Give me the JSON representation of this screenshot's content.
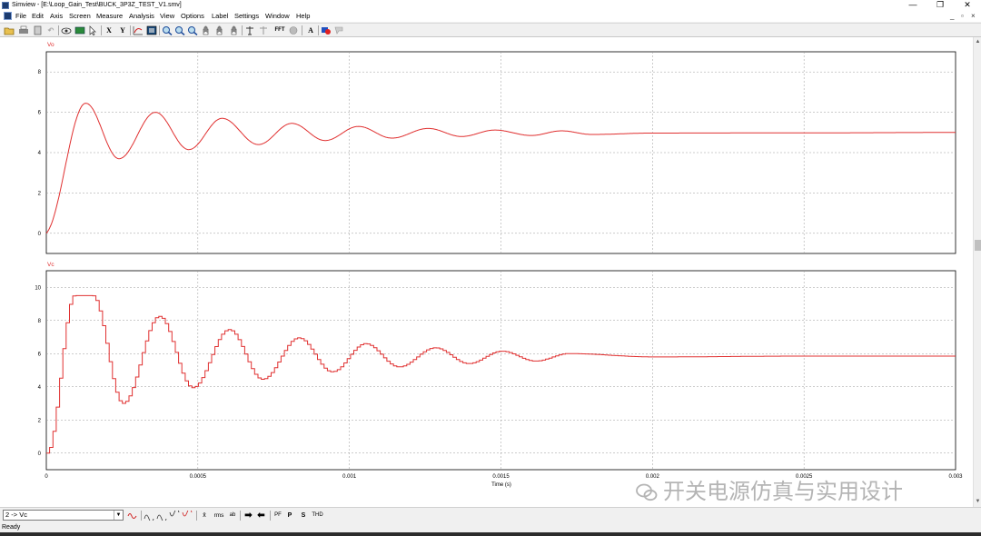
{
  "window": {
    "title": "Simview - [E:\\Loop_Gain_Test\\BUCK_3P3Z_TEST_V1.smv]",
    "controls": [
      "—",
      "❐",
      "✕"
    ]
  },
  "menu": [
    "File",
    "Edit",
    "Axis",
    "Screen",
    "Measure",
    "Analysis",
    "View",
    "Options",
    "Label",
    "Settings",
    "Window",
    "Help"
  ],
  "mdi_controls": [
    "_",
    "▫",
    "×"
  ],
  "toolbar": {
    "x_label": "X",
    "y_label": "Y",
    "fft_label": "FFT",
    "text_label": "A"
  },
  "plots": {
    "top": {
      "trace_label": "Vo"
    },
    "bottom": {
      "trace_label": "Vc"
    },
    "xlabel": "Time (s)"
  },
  "chart_data": [
    {
      "type": "line",
      "series": [
        {
          "name": "Vo",
          "color": "#e03030"
        }
      ],
      "xlim": [
        0,
        0.003
      ],
      "ylim": [
        -1,
        9
      ],
      "yticks": [
        0,
        2,
        4,
        6,
        8
      ],
      "x": [
        0,
        0.00013,
        0.00024,
        0.00036,
        0.00047,
        0.00058,
        0.0007,
        0.00081,
        0.00092,
        0.00103,
        0.00114,
        0.00126,
        0.00137,
        0.00148,
        0.0016,
        0.0017,
        0.0018,
        0.002,
        0.0025,
        0.003
      ],
      "y": [
        0,
        6.45,
        3.7,
        6.0,
        4.15,
        5.7,
        4.4,
        5.45,
        4.6,
        5.3,
        4.72,
        5.2,
        4.8,
        5.12,
        4.85,
        5.08,
        4.9,
        4.97,
        4.98,
        5.0
      ],
      "grid": true
    },
    {
      "type": "line",
      "series": [
        {
          "name": "Vc",
          "color": "#e03030",
          "style": "stepped"
        }
      ],
      "xlim": [
        0,
        0.003
      ],
      "xticks": [
        0,
        0.0005,
        0.001,
        0.0015,
        0.002,
        0.0025,
        0.003
      ],
      "xticklabels": [
        "0",
        "0.0005",
        "0.001",
        "0.0015",
        "0.002",
        "0.0025",
        "0.003"
      ],
      "xlabel": "Time (s)",
      "ylim": [
        -1,
        11
      ],
      "yticks": [
        0,
        2,
        4,
        6,
        8,
        10
      ],
      "x": [
        0,
        9e-05,
        0.00015,
        0.00025,
        0.00037,
        0.00048,
        0.0006,
        0.00071,
        0.00083,
        0.00094,
        0.00105,
        0.00116,
        0.00128,
        0.00139,
        0.0015,
        0.00161,
        0.00172,
        0.002,
        0.0025,
        0.003
      ],
      "y": [
        0,
        9.5,
        9.5,
        3.0,
        8.25,
        3.95,
        7.45,
        4.45,
        6.95,
        4.9,
        6.6,
        5.2,
        6.35,
        5.4,
        6.15,
        5.55,
        6.0,
        5.8,
        5.85,
        5.85
      ],
      "grid": true
    }
  ],
  "bottom_toolbar": {
    "signal_select": "2 -> Vc",
    "buttons": [
      "x̄",
      "rms",
      "ab",
      "PF",
      "P",
      "S",
      "THD"
    ]
  },
  "watermark": "开关电源仿真与实用设计",
  "status": "Ready"
}
